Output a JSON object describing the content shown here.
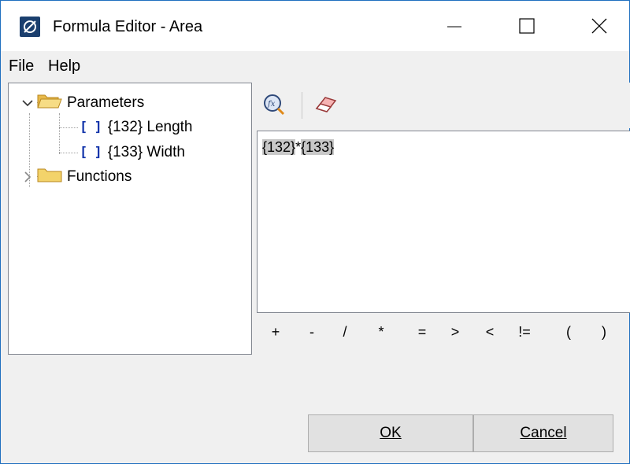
{
  "window": {
    "title": "Formula Editor - Area"
  },
  "menu": {
    "file": "File",
    "help": "Help"
  },
  "tree": {
    "parameters_label": "Parameters",
    "items": [
      {
        "label": "{132} Length"
      },
      {
        "label": "{133} Width"
      }
    ],
    "functions_label": "Functions"
  },
  "editor": {
    "token1": "{132}",
    "operator": "*",
    "token2": "{133}"
  },
  "operators": [
    "+",
    "-",
    "/",
    "*",
    "=",
    ">",
    "<",
    "!=",
    "(",
    ")"
  ],
  "buttons": {
    "ok": "OK",
    "cancel": "Cancel"
  },
  "icons": {
    "app": "formula-app-icon",
    "fx": "function-search-icon",
    "eraser": "eraser-icon",
    "folder": "folder-icon",
    "param": "parameter-bracket-icon"
  },
  "colors": {
    "accent": "#1f6fbf",
    "param_icon": "#1133aa",
    "folder": "#f3d36a"
  }
}
